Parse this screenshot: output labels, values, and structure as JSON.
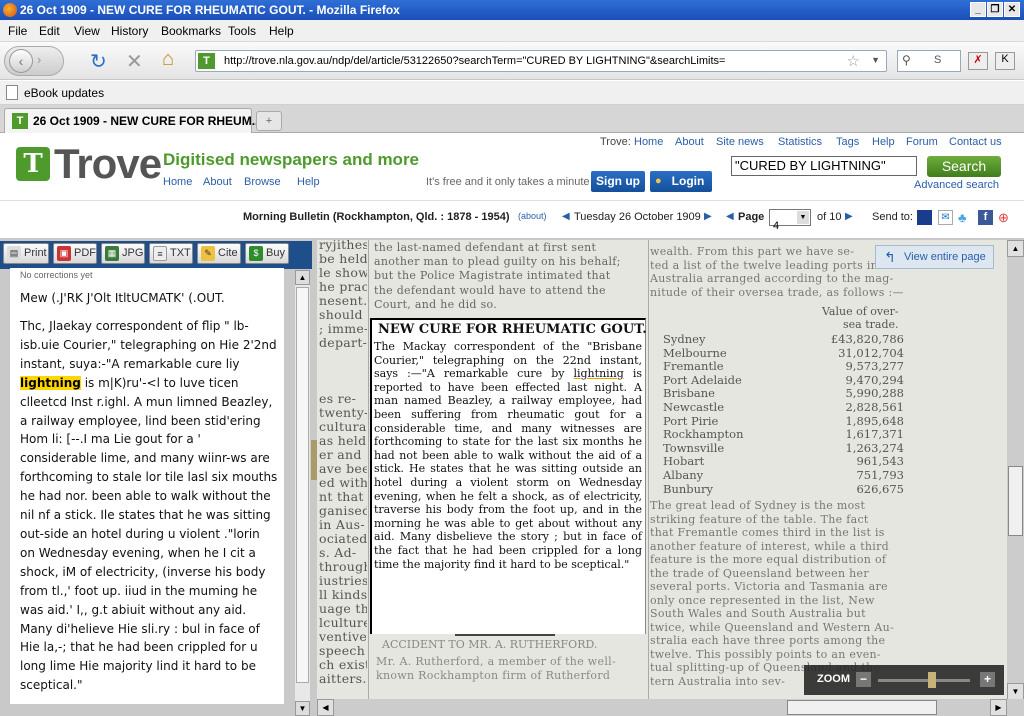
{
  "window": {
    "title": "26 Oct 1909 - NEW CURE FOR RHEUMATIC GOUT. - Mozilla Firefox"
  },
  "menu": [
    "File",
    "Edit",
    "View",
    "History",
    "Bookmarks",
    "Tools",
    "Help"
  ],
  "nav": {
    "url": "http://trove.nla.gov.au/ndp/del/article/53122650?searchTerm=\"CURED BY LIGHTNING\"&searchLimits=",
    "search_engine_text": "S"
  },
  "bookmarks": [
    {
      "label": "eBook updates"
    }
  ],
  "tabs": [
    {
      "label": "26 Oct 1909 - NEW CURE FOR RHEUM..."
    }
  ],
  "trove": {
    "logo_text": "Trove",
    "tagline": "Digitised newspapers and more",
    "nav": [
      "Home",
      "About",
      "Browse",
      "Help"
    ],
    "top_label": "Trove:",
    "top_links": [
      "Home",
      "About",
      "Site news",
      "Statistics",
      "Tags",
      "Help",
      "Forum",
      "Contact us"
    ],
    "free_text": "It's free and it only takes a minute",
    "signup": "Sign up",
    "login": "Login",
    "search_value": "\"CURED BY LIGHTNING\"",
    "search_button": "Search",
    "advanced": "Advanced search"
  },
  "infobar": {
    "paper": "Morning Bulletin (Rockhampton, Qld. : 1878 - 1954)",
    "about": "(about)",
    "date": "Tuesday 26 October 1909",
    "page_label": "Page",
    "page_value": "4",
    "page_total": "of 10",
    "send_to": "Send to:"
  },
  "toolbar": [
    "Print",
    "PDF",
    "JPG",
    "TXT",
    "Cite",
    "Buy"
  ],
  "ocr": {
    "corrections": "No corrections yet",
    "heading": "Mew (.J'RK J'Olt ItltUCMATK' (.OUT.",
    "before": "Thc, Jlaekay correspondent of flip \" lb-isb.uie Courier,\" telegraphing on Hie 2'2nd instant, suya:-\"A remarkable cure liy ",
    "highlight": "lightning",
    "after": " is m|K)ru'-<l to luve ticen clleetcd Inst r.ighl. A mun limned Beazley, a railway employee, lind been stid'ering Hom li: [--.I ma Lie gout for a ' considerable lime, and many wiinr-ws are forthcoming to stale lor tile lasl six mouths he had nor. been able to walk without the nil nf a stick. Ile states that he was sitting out-side an hotel during u violent .\"lorin on Wednesday evening, when he I cit a shock, iM of electricity, (inverse his body from tl.,' foot up. iiud in the muming he was aid.' I,, g.t abiuit without any aid. Many di'helieve Hie sli.ry : bul in face of Hie la,-; that he had been crippled for u long lime Hie majority lind it hard to be sceptical.\""
  },
  "article": {
    "title": "NEW CURE FOR RHEUMATIC GOUT.",
    "body_before": "The Mackay correspondent of the \"Brisbane Courier,\" telegraphing on the 22nd instant, says :—\"A remarkable cure by ",
    "body_word": "lightning",
    "body_after": " is reported to have been effected last night. A man named Beazley, a railway employee, had been suffering from rheumatic gout for a considerable time, and many witnesses are forthcoming to state for the last six months he had not been able to walk without the aid of a stick. He states that he was sitting outside an hotel during a violent storm on Wednesday evening, when he felt a shock, as of electricity, traverse his body from the foot up, and in the morning he was able to get about without any aid. Many disbelieve the story ; but in face of the fact that he had been crippled for a long time the majority find it hard to be sceptical.\"",
    "next_heading": "ACCIDENT TO MR. A. RUTHERFORD.",
    "next_lines": [
      "Mr. A. Rutherford, a member of the well-",
      "known Rockhampton firm of Rutherford"
    ],
    "above_lines": [
      "the last-named defendant at first sent",
      "another man to plead guilty on his behalf;",
      "but the Police Magistrate intimated that",
      "the defendant would have to attend the",
      "Court, and he did so."
    ]
  },
  "left_col": [
    "ryjithess",
    "be held",
    "le shows",
    "he prac-",
    "nesent.",
    "should",
    "; imme-",
    "depart-",
    "",
    "",
    "",
    "es re-",
    "twenty-",
    "cultural",
    "as held",
    "er and",
    "ave been",
    "ed with",
    "nt that",
    "ganised",
    "in Aus-",
    "ociated",
    "s. Ad-",
    "through",
    "iustries",
    "ll kinds",
    "uage the",
    "lculture",
    "ventive",
    "speech",
    "ch exist",
    "aitters."
  ],
  "right_col": {
    "top_lines": [
      "wealth. From this part we have se-",
      "ted a list of the twelve leading ports in",
      "Australia arranged according to the mag-",
      "nitude of their oversea trade, as follows :—"
    ],
    "value_header": "Value of over-",
    "value_header2": "sea trade.",
    "ports": [
      {
        "name": "Sydney",
        "value": "£43,820,786"
      },
      {
        "name": "Melbourne",
        "value": "31,012,704"
      },
      {
        "name": "Fremantle",
        "value": "9,573,277"
      },
      {
        "name": "Port Adelaide",
        "value": "9,470,294"
      },
      {
        "name": "Brisbane",
        "value": "5,990,288"
      },
      {
        "name": "Newcastle",
        "value": "2,828,561"
      },
      {
        "name": "Port Pirie",
        "value": "1,895,648"
      },
      {
        "name": "Rockhampton",
        "value": "1,617,371"
      },
      {
        "name": "Townsville",
        "value": "1,263,274"
      },
      {
        "name": "Hobart",
        "value": "961,543"
      },
      {
        "name": "Albany",
        "value": "751,793"
      },
      {
        "name": "Bunbury",
        "value": "626,675"
      }
    ],
    "bottom_lines": [
      "The great lead of Sydney is the most",
      "striking feature of the table. The fact",
      "that Fremantle comes third in the list is",
      "another feature of interest, while a third",
      "feature is the more equal distribution of",
      "the trade of Queensland between her",
      "several ports. Victoria and Tasmania are",
      "only once represented in the list, New",
      "South Wales and South Australia but",
      "twice, while Queensland and Western Au-",
      "stralia each have three ports among the",
      "twelve. This possibly points to an even-",
      "tual splitting-up of Queensland and the",
      "tern Australia into sev-"
    ]
  },
  "viewer": {
    "view_entire": "View entire page",
    "zoom_label": "ZOOM"
  }
}
